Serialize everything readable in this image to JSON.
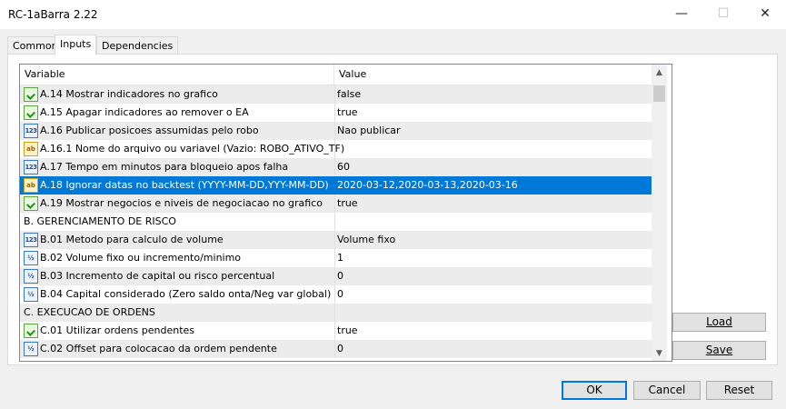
{
  "window": {
    "title": "RC-1aBarra 2.22",
    "minimize_glyph": "—",
    "maximize_glyph": "☐",
    "close_glyph": "✕"
  },
  "tabs": [
    {
      "label": "Common"
    },
    {
      "label": "Inputs"
    },
    {
      "label": "Dependencies"
    }
  ],
  "active_tab": "Inputs",
  "table": {
    "headers": {
      "variable": "Variable",
      "value": "Value"
    },
    "rows": [
      {
        "icon": "bool-icon",
        "variable": "A.14 Mostrar indicadores no grafico",
        "value": "false"
      },
      {
        "icon": "bool-icon",
        "variable": "A.15 Apagar indicadores ao remover o EA",
        "value": "true"
      },
      {
        "icon": "number-icon",
        "variable": "A.16 Publicar posicoes assumidas pelo robo",
        "value": "Nao publicar"
      },
      {
        "icon": "string-icon",
        "variable": "A.16.1 Nome do arquivo ou variavel (Vazio: ROBO_ATIVO_TF)",
        "value": ""
      },
      {
        "icon": "number-icon",
        "variable": "A.17 Tempo em minutos para bloqueio apos falha",
        "value": "60"
      },
      {
        "icon": "string-icon",
        "variable": "A.18 Ignorar datas no backtest (YYYY-MM-DD,YYY-MM-DD)",
        "value": "2020-03-12,2020-03-13,2020-03-16",
        "selected": true
      },
      {
        "icon": "bool-icon",
        "variable": "A.19 Mostrar negocios e niveis de negociacao no grafico",
        "value": "true"
      },
      {
        "icon": "",
        "variable": "B. GERENCIAMENTO DE RISCO",
        "value": ""
      },
      {
        "icon": "number-icon",
        "variable": "B.01 Metodo para calculo de volume",
        "value": "Volume fixo"
      },
      {
        "icon": "fraction-icon",
        "variable": "B.02 Volume fixo ou incremento/minimo",
        "value": "1"
      },
      {
        "icon": "fraction-icon",
        "variable": "B.03 Incremento de capital ou risco percentual",
        "value": "0"
      },
      {
        "icon": "fraction-icon",
        "variable": "B.04 Capital considerado (Zero saldo onta/Neg var global)",
        "value": "0"
      },
      {
        "icon": "",
        "variable": "C. EXECUCAO DE ORDENS",
        "value": ""
      },
      {
        "icon": "bool-icon",
        "variable": "C.01 Utilizar ordens pendentes",
        "value": "true"
      },
      {
        "icon": "fraction-icon",
        "variable": "C.02 Offset para colocacao da ordem pendente",
        "value": "0"
      }
    ]
  },
  "icon_glyphs": {
    "number-icon": "123",
    "string-icon": "ab",
    "fraction-icon": "½"
  },
  "side_buttons": {
    "load_label": "Load",
    "save_label": "Save"
  },
  "bottom_buttons": {
    "ok_label": "OK",
    "cancel_label": "Cancel",
    "reset_label": "Reset"
  },
  "colors": {
    "selection": "#0078d7",
    "alt_row": "#ececec"
  }
}
